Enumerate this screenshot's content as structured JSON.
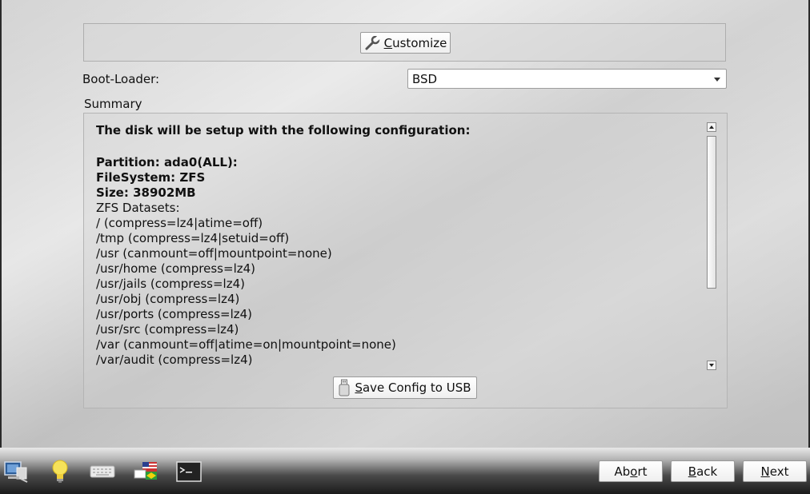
{
  "customize_button": {
    "label_prefix": "",
    "mnemonic": "C",
    "label_rest": "ustomize",
    "icon": "wrench-icon"
  },
  "bootloader": {
    "label": "Boot-Loader:",
    "selected": "BSD"
  },
  "summary": {
    "label": "Summary",
    "heading": "The disk will be setup with the following configuration:",
    "bold_lines": [
      "Partition: ada0(ALL):",
      "FileSystem: ZFS",
      "Size: 38902MB"
    ],
    "datasets_label": "ZFS Datasets:",
    "datasets": [
      "/ (compress=lz4|atime=off)",
      "/tmp (compress=lz4|setuid=off)",
      "/usr (canmount=off|mountpoint=none)",
      "/usr/home (compress=lz4)",
      "/usr/jails (compress=lz4)",
      "/usr/obj (compress=lz4)",
      "/usr/ports (compress=lz4)",
      "/usr/src (compress=lz4)",
      "/var (canmount=off|atime=on|mountpoint=none)",
      "/var/audit (compress=lz4)"
    ]
  },
  "usb_button": {
    "mnemonic": "S",
    "label_rest": "ave Config to USB",
    "icon": "usb-drive-icon"
  },
  "taskbar": {
    "icons": [
      "system-info-icon",
      "hint-lightbulb-icon",
      "keyboard-icon",
      "language-flags-icon",
      "terminal-icon"
    ]
  },
  "nav": {
    "abort": {
      "pre": "Ab",
      "mnemonic": "o",
      "post": "rt"
    },
    "back": {
      "pre": "",
      "mnemonic": "B",
      "post": "ack"
    },
    "next": {
      "pre": "",
      "mnemonic": "N",
      "post": "ext"
    }
  }
}
